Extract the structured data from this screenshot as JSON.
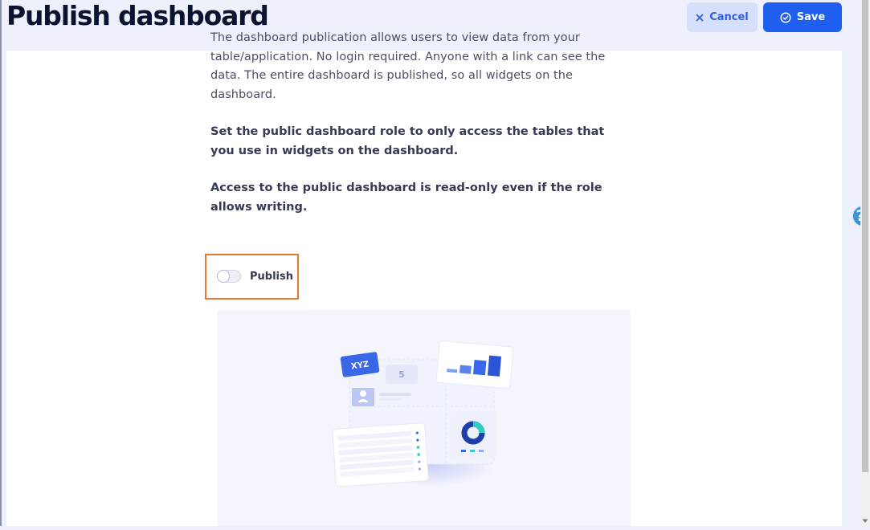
{
  "header": {
    "title": "Publish dashboard",
    "cancel_label": "Cancel",
    "save_label": "Save",
    "cancel_icon": "close-icon",
    "save_icon": "check-circle-icon"
  },
  "content": {
    "intro": "The dashboard publication allows users to view data from your table/application. No login required. Anyone with a link can see the data. The entire dashboard is published, so all widgets on the dashboard.",
    "role_note": "Set the public dashboard role to only access the tables that you use in widgets on the dashboard.",
    "readonly_note": "Access to the public dashboard is read-only even if the role allows writing."
  },
  "publish_toggle": {
    "label": "Publish",
    "on": false
  },
  "illustration": {
    "tag_text": "XYZ",
    "number_card": "5",
    "icon": "dashboard-illustration"
  },
  "help": {
    "label": "?"
  },
  "colors": {
    "primary": "#1f5ff0",
    "highlight_border": "#e8762b",
    "title": "#0c1330"
  }
}
